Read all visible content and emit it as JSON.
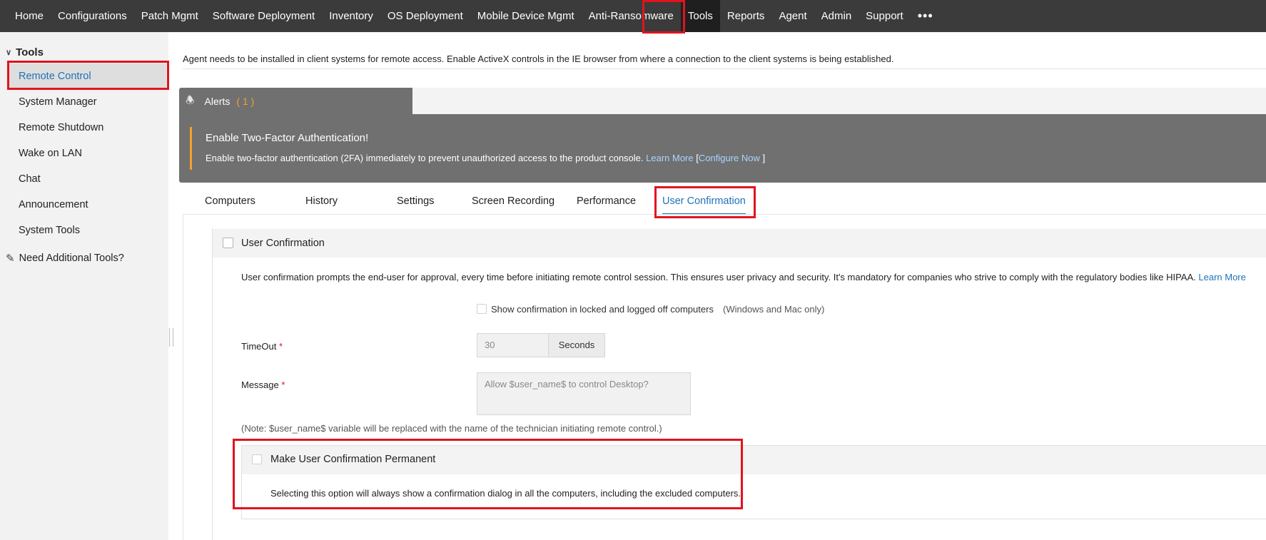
{
  "topnav": {
    "items": [
      "Home",
      "Configurations",
      "Patch Mgmt",
      "Software Deployment",
      "Inventory",
      "OS Deployment",
      "Mobile Device Mgmt",
      "Anti-Ransomware",
      "Tools",
      "Reports",
      "Agent",
      "Admin",
      "Support"
    ],
    "active": "Tools",
    "more": "•••"
  },
  "sidebar": {
    "section": "Tools",
    "items": [
      "Remote Control",
      "System Manager",
      "Remote Shutdown",
      "Wake on LAN",
      "Chat",
      "Announcement",
      "System Tools"
    ],
    "active": "Remote Control",
    "extra": "Need Additional Tools?"
  },
  "main": {
    "notice": "Agent needs to be installed in client systems for remote access. Enable ActiveX controls in the IE browser from where a connection to the client systems is being established.",
    "alerts": {
      "label": "Alerts",
      "count": "( 1 )",
      "title": "Enable Two-Factor Authentication!",
      "text": "Enable two-factor authentication (2FA) immediately to prevent unauthorized access to the product console.",
      "learn_more": "Learn More",
      "bracket_open": "[",
      "configure_now": "Configure Now",
      "bracket_close": "]"
    },
    "tabs": [
      "Computers",
      "History",
      "Settings",
      "Screen Recording",
      "Performance",
      "User Confirmation"
    ],
    "active_tab": "User Confirmation",
    "panel": {
      "title": "User Confirmation",
      "description": "User confirmation prompts the end-user for approval, every time before initiating remote control session. This ensures user privacy and security. It's mandatory for companies who strive to comply with the regulatory bodies like HIPAA.",
      "learn_more": "Learn More",
      "show_confirmation": "Show confirmation in locked and logged off computers",
      "show_confirmation_note": "(Windows and Mac only)",
      "timeout_label": "TimeOut",
      "timeout_value": "30",
      "timeout_unit": "Seconds",
      "message_label": "Message",
      "message_placeholder": "Allow $user_name$ to control Desktop?",
      "required_mark": "*",
      "note": "(Note: $user_name$ variable will be replaced with the name of the technician initiating remote control.)",
      "permanent": {
        "label": "Make User Confirmation Permanent",
        "description": "Selecting this option will always show a confirmation dialog in all the computers, including the excluded computers."
      }
    }
  },
  "colors": {
    "highlight": "#e0141e",
    "link": "#1f72b8",
    "alert_accent": "#f0a22a",
    "nav_bg": "#3b3b3b"
  }
}
